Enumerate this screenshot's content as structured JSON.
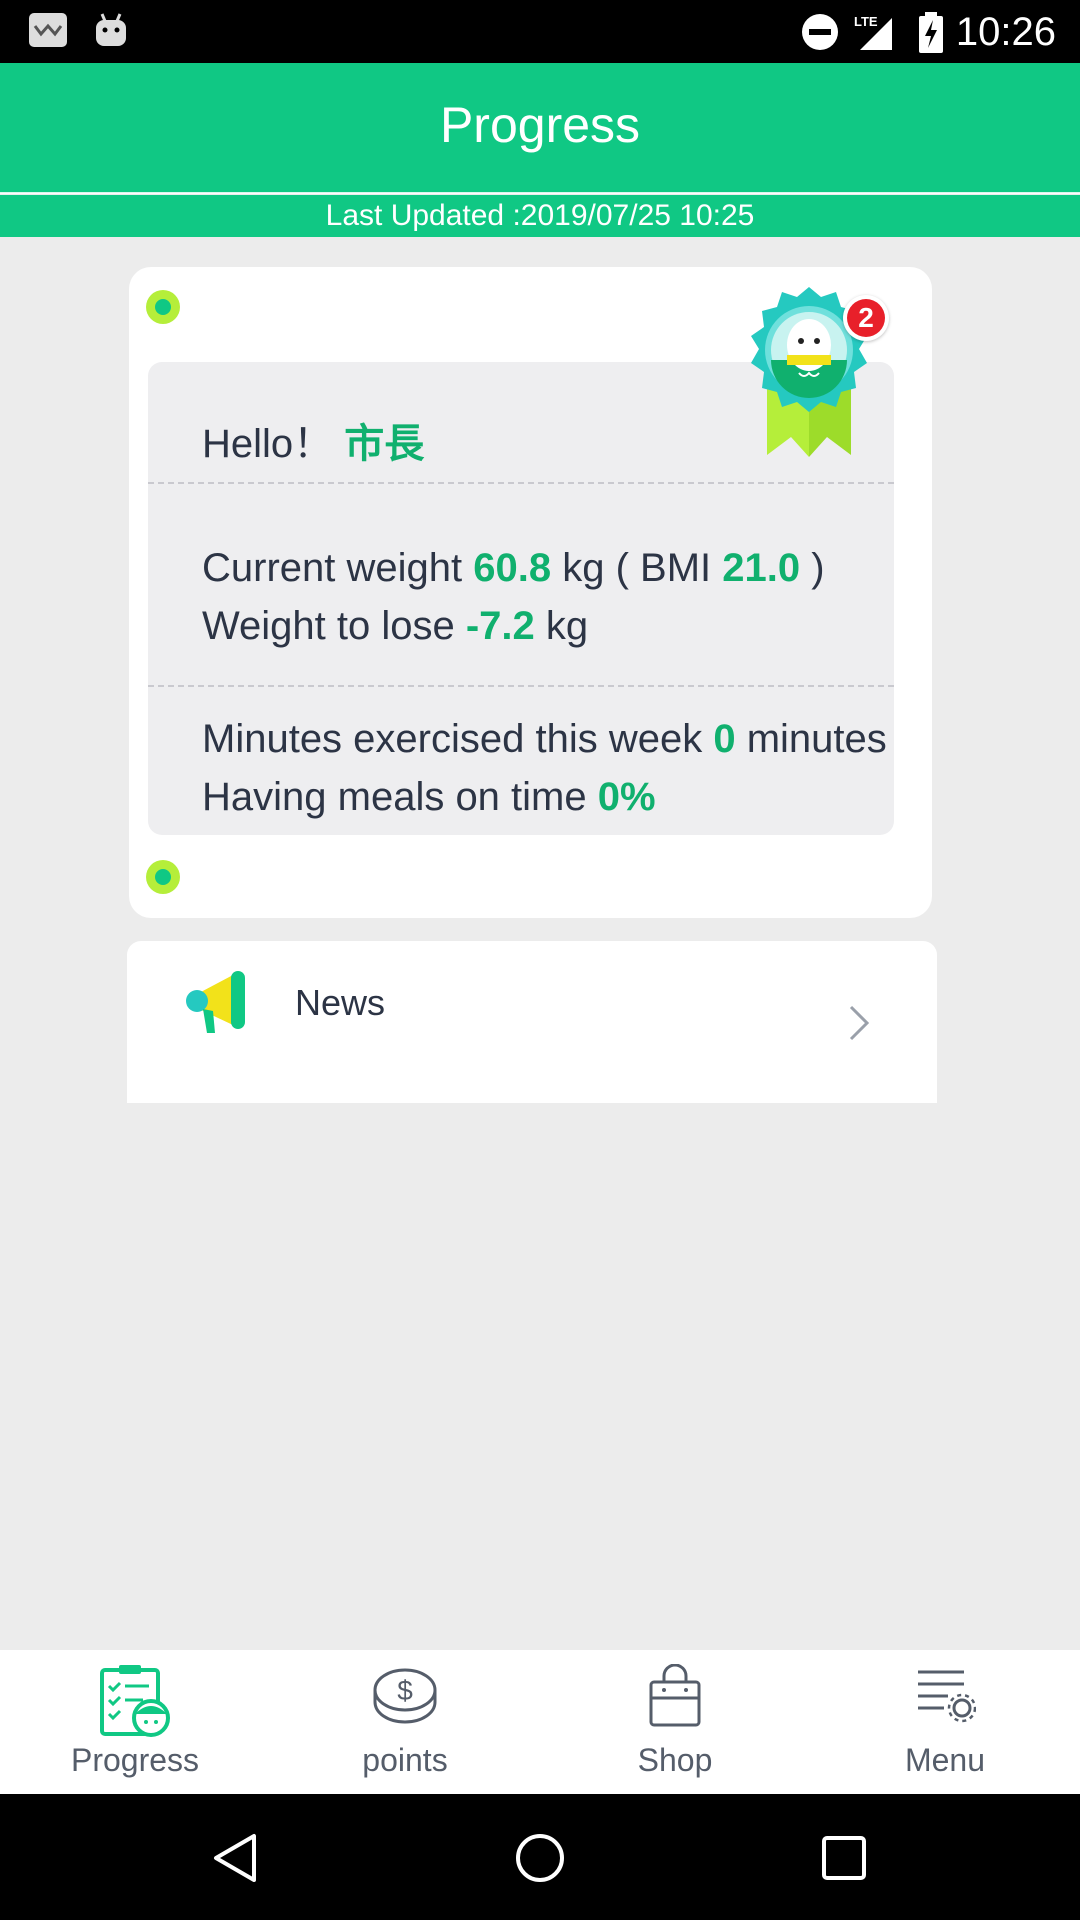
{
  "status_bar": {
    "time": "10:26",
    "network": "LTE"
  },
  "header": {
    "title": "Progress",
    "last_updated": "Last Updated :2019/07/25 10:25"
  },
  "summary": {
    "greeting": "Hello！",
    "user_name": "市長",
    "badge_count": "2",
    "weight_label": "Current weight",
    "weight_value": "60.8",
    "weight_unit": "kg ( BMI",
    "bmi_value": "21.0",
    "bmi_close": ")",
    "lose_label": "Weight to lose",
    "lose_value": "-7.2",
    "lose_unit": "kg",
    "exercise_label": "Minutes exercised this week",
    "exercise_value": "0",
    "exercise_unit": "minutes",
    "meals_label": "Having meals on time",
    "meals_value": "0%"
  },
  "news": {
    "label": "News"
  },
  "tabs": [
    {
      "label": "Progress",
      "icon": "progress-checklist-icon",
      "active": true
    },
    {
      "label": "points",
      "icon": "coin-icon",
      "active": false
    },
    {
      "label": "Shop",
      "icon": "shopping-bag-icon",
      "active": false
    },
    {
      "label": "Menu",
      "icon": "menu-settings-icon",
      "active": false
    }
  ],
  "colors": {
    "accent": "#10c884",
    "value_green": "#10b06e",
    "dot_lime": "#b5ee3a",
    "badge_red": "#e8202a"
  }
}
